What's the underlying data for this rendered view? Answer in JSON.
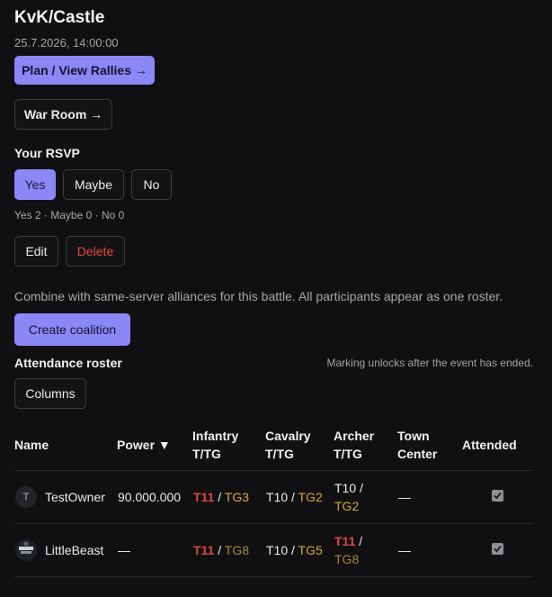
{
  "event": {
    "title": "KvK/Castle",
    "datetime": "25.7.2026, 14:00:00",
    "plan_button": "Plan / View Rallies →",
    "war_room_button": "War Room →"
  },
  "rsvp": {
    "label": "Your RSVP",
    "options": [
      "Yes",
      "Maybe",
      "No"
    ],
    "selected": "Yes",
    "summary": "Yes 2 · Maybe 0 · No 0"
  },
  "actions": {
    "edit": "Edit",
    "delete": "Delete"
  },
  "coalition": {
    "description": "Combine with same-server alliances for this battle. All participants appear as one roster.",
    "button": "Create coalition"
  },
  "roster": {
    "title": "Attendance roster",
    "note": "Marking unlocks after the event has ended.",
    "columns_button": "Columns",
    "headers": {
      "name": "Name",
      "power": "Power ▼",
      "infantry_1": "Infantry",
      "infantry_2": "T/TG",
      "cavalry_1": "Cavalry",
      "cavalry_2": "T/TG",
      "archer_1": "Archer",
      "archer_2": "T/TG",
      "town_1": "Town",
      "town_2": "Center",
      "attended": "Attended"
    },
    "rows": [
      {
        "avatar": "T",
        "name": "TestOwner",
        "power": "90.000.000",
        "infantry_t": "T11",
        "infantry_tg": "TG3",
        "cavalry_t": "T10",
        "cavalry_tg": "TG2",
        "archer_t": "T10",
        "archer_tg": "TG2",
        "town_center": "—",
        "attended": true
      },
      {
        "avatar_icon": "player-avatar-image",
        "name": "LittleBeast",
        "power": "—",
        "infantry_t": "T11",
        "infantry_tg": "TG8",
        "cavalry_t": "T10",
        "cavalry_tg": "TG5",
        "archer_t": "T11",
        "archer_tg": "TG8",
        "town_center": "—",
        "attended": true
      }
    ],
    "separator": " / "
  },
  "colors": {
    "accent": "#8b87f7",
    "danger": "#e0483e",
    "tg_bright": "#dba729",
    "tg_muted": "#a8872c",
    "background": "#101012"
  }
}
